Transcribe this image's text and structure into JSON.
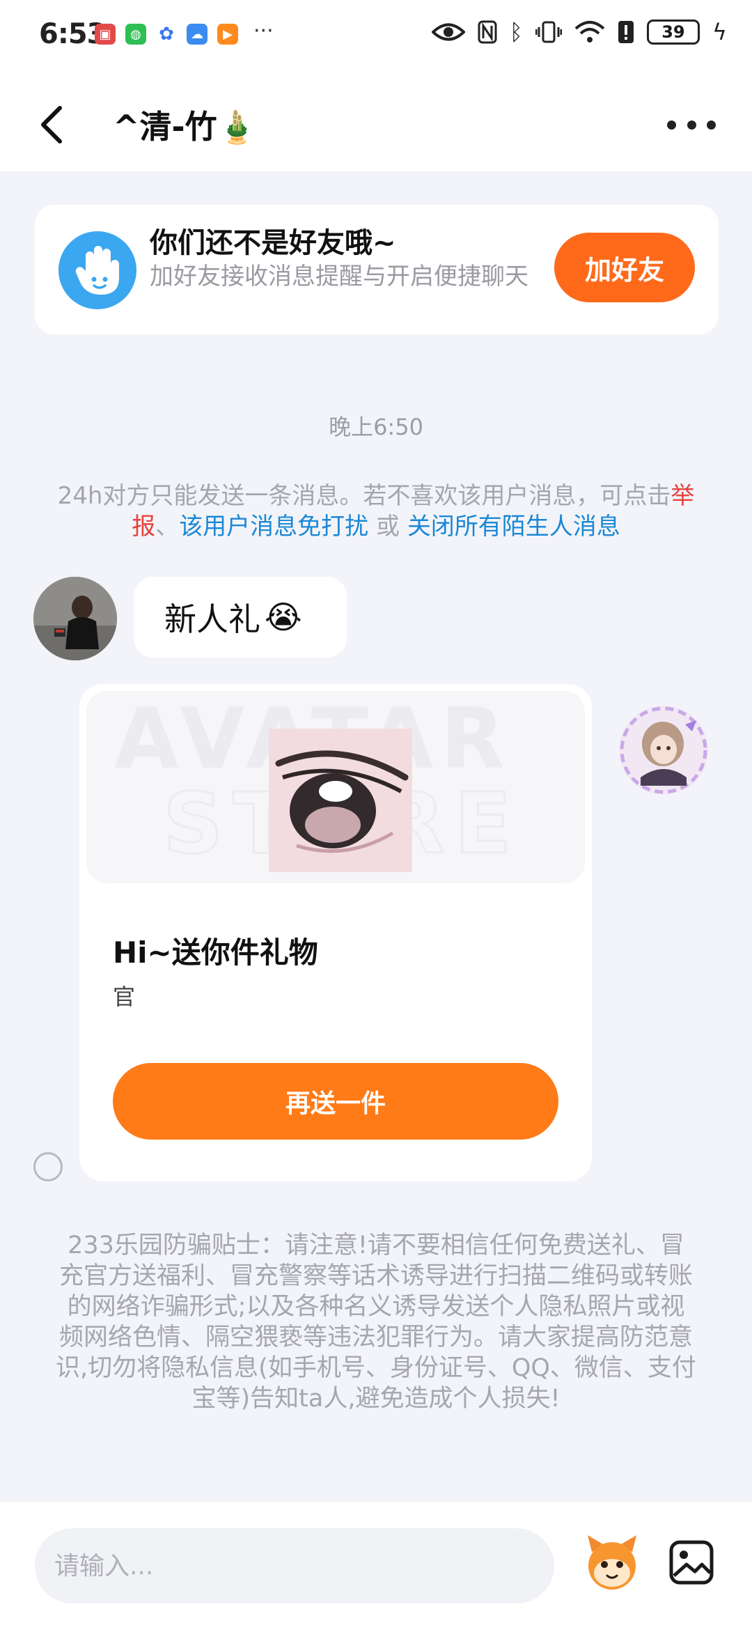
{
  "status_bar": {
    "time": "6:53",
    "more_apps": "···",
    "battery": "39",
    "app_icons": [
      {
        "name": "huawei-icon",
        "color": "#e24a4a"
      },
      {
        "name": "wechat-icon",
        "color": "#2fbf55"
      },
      {
        "name": "baidu-icon",
        "color": "#3a76f0"
      },
      {
        "name": "cloud-icon",
        "color": "#3a8cf0"
      },
      {
        "name": "player-icon",
        "color": "#ff8a1e"
      }
    ]
  },
  "header": {
    "title": "^清-竹🎍"
  },
  "friend_banner": {
    "title": "你们还不是好友哦~",
    "subtitle": "加好友接收消息提醒与开启便捷聊天",
    "button": "加好友"
  },
  "chat": {
    "time": "晚上6:50",
    "notice": {
      "prefix": "24h对方只能发送一条消息。若不喜欢该用户消息，可点击",
      "report": "举报",
      "sep1": "、",
      "mute": "该用户消息免打扰",
      "or": " 或 ",
      "close_all": "关闭所有陌生人消息"
    },
    "incoming": {
      "text": "新人礼",
      "emoji": "😭"
    },
    "gift": {
      "watermark": "AVATAR STORE",
      "title": "Hi~送你件礼物",
      "subtitle": "官",
      "button": "再送一件"
    },
    "warning": "233乐园防骗贴士：请注意!请不要相信任何免费送礼、冒充官方送福利、冒充警察等话术诱导进行扫描二维码或转账的网络诈骗形式;以及各种名义诱导发送个人隐私照片或视频网络色情、隔空猥亵等违法犯罪行为。请大家提高防范意识,切勿将隐私信息(如手机号、身份证号、QQ、微信、支付宝等)告知ta人,避免造成个人损失!"
  },
  "input": {
    "placeholder": "请输入..."
  },
  "colors": {
    "accent": "#fe6a1a",
    "link_blue": "#1a88d6",
    "report_red": "#e8413c",
    "background": "#f3f4f9"
  }
}
